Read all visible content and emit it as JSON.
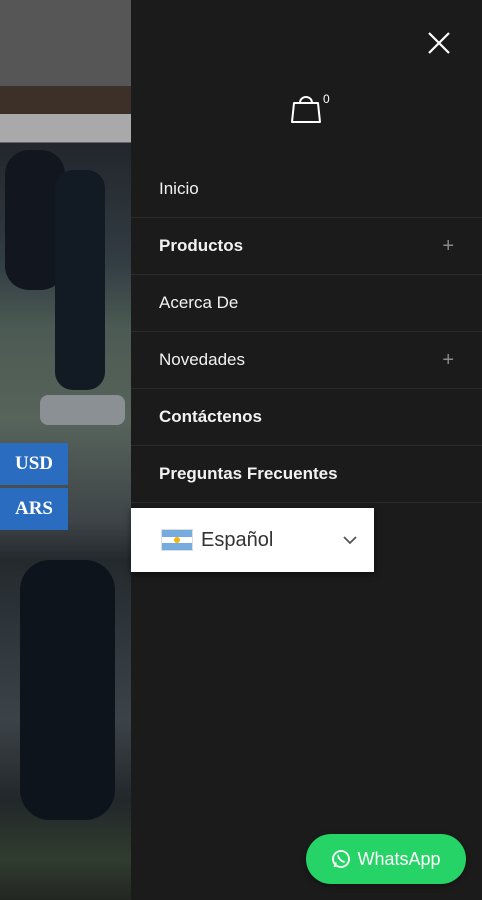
{
  "currency": {
    "options": [
      "USD",
      "ARS"
    ]
  },
  "drawer": {
    "cart_count": "0",
    "menu": [
      {
        "label": "Inicio",
        "bold": false,
        "expandable": false
      },
      {
        "label": "Productos",
        "bold": true,
        "expandable": true
      },
      {
        "label": "Acerca De",
        "bold": false,
        "expandable": false
      },
      {
        "label": "Novedades",
        "bold": false,
        "expandable": true
      },
      {
        "label": "Contáctenos",
        "bold": true,
        "expandable": false
      },
      {
        "label": "Preguntas Frecuentes",
        "bold": true,
        "expandable": false
      }
    ],
    "expand_symbol": "+",
    "language": {
      "selected": "Español",
      "flag": "argentina-flag-icon"
    }
  },
  "whatsapp": {
    "label": "WhatsApp",
    "color": "#25d366"
  },
  "colors": {
    "drawer_bg": "#1b1b1b",
    "currency_bg": "#2a6cbf"
  }
}
